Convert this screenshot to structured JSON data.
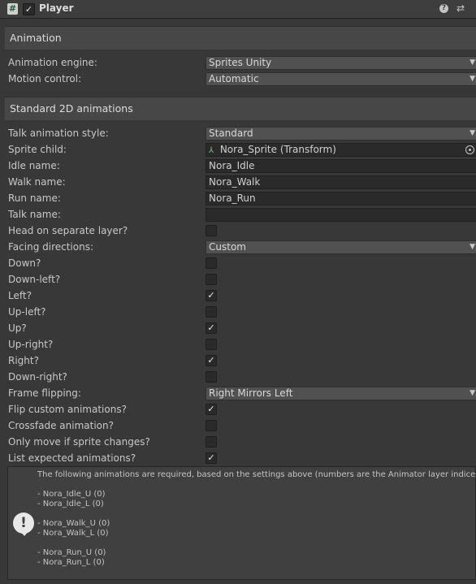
{
  "component": {
    "title": "Player",
    "script_icon": "script-hash-icon",
    "enabled": true,
    "help_icon": "question-circle-icon",
    "settings_icon": "sliders-icon"
  },
  "sections": {
    "animation": "Animation",
    "standard2d": "Standard 2D animations"
  },
  "fields": {
    "animation_engine": {
      "label": "Animation engine:",
      "value": "Sprites Unity"
    },
    "motion_control": {
      "label": "Motion control:",
      "value": "Automatic"
    },
    "talk_animation_style": {
      "label": "Talk animation style:",
      "value": "Standard"
    },
    "sprite_child": {
      "label": "Sprite child:",
      "value": "Nora_Sprite (Transform)"
    },
    "idle_name": {
      "label": "Idle name:",
      "value": "Nora_Idle"
    },
    "walk_name": {
      "label": "Walk name:",
      "value": "Nora_Walk"
    },
    "run_name": {
      "label": "Run name:",
      "value": "Nora_Run"
    },
    "talk_name": {
      "label": "Talk name:",
      "value": ""
    },
    "head_separate": {
      "label": "Head on separate layer?",
      "checked": false
    },
    "facing_directions": {
      "label": "Facing directions:",
      "value": "Custom"
    },
    "down": {
      "label": "Down?",
      "checked": false
    },
    "down_left": {
      "label": "Down-left?",
      "checked": false
    },
    "left": {
      "label": "Left?",
      "checked": true
    },
    "up_left": {
      "label": "Up-left?",
      "checked": false
    },
    "up": {
      "label": "Up?",
      "checked": true
    },
    "up_right": {
      "label": "Up-right?",
      "checked": false
    },
    "right": {
      "label": "Right?",
      "checked": true
    },
    "down_right": {
      "label": "Down-right?",
      "checked": false
    },
    "frame_flipping": {
      "label": "Frame flipping:",
      "value": "Right Mirrors Left"
    },
    "flip_custom": {
      "label": "Flip custom animations?",
      "checked": true
    },
    "crossfade": {
      "label": "Crossfade animation?",
      "checked": false
    },
    "only_move": {
      "label": "Only move if sprite changes?",
      "checked": false
    },
    "list_expected": {
      "label": "List expected animations?",
      "checked": true
    }
  },
  "helpbox": {
    "intro": "The following animations are required, based on the settings above (numbers are the Animator layer indices):",
    "lines": [
      "- Nora_Idle_U   (0)",
      "- Nora_Idle_L   (0)",
      "- Nora_Walk_U   (0)",
      "- Nora_Walk_L   (0)",
      "- Nora_Run_U   (0)",
      "- Nora_Run_L   (0)"
    ],
    "icon": "warning-speech-bubble-icon"
  },
  "check_glyph": "✓",
  "caret_glyph": "▼"
}
